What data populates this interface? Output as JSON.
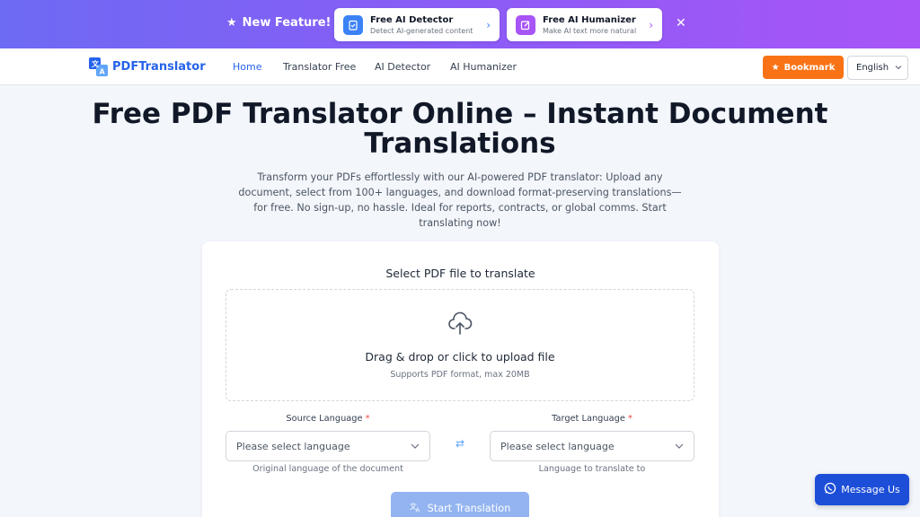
{
  "promo": {
    "label": "New Feature!",
    "cards": [
      {
        "title": "Free AI Detector",
        "subtitle": "Detect AI-generated content"
      },
      {
        "title": "Free AI Humanizer",
        "subtitle": "Make AI text more natural"
      }
    ],
    "close_label": "✕"
  },
  "nav": {
    "brand": "PDFTranslator",
    "links": [
      "Home",
      "Translator Free",
      "AI Detector",
      "AI Humanizer"
    ],
    "bookmark_label": "Bookmark",
    "language": "English"
  },
  "hero": {
    "title": "Free PDF Translator Online – Instant Document Translations",
    "subtitle": "Transform your PDFs effortlessly with our AI-powered PDF translator: Upload any document, select from 100+ languages, and download format-preserving translations—for free. No sign-up, no hassle. Ideal for reports, contracts, or global comms. Start translating now!"
  },
  "upload": {
    "title": "Select PDF file to translate",
    "drop_text": "Drag & drop or click to upload file",
    "drop_hint": "Supports PDF format, max 20MB"
  },
  "source": {
    "label": "Source Language",
    "required_mark": "*",
    "placeholder": "Please select language",
    "hint": "Original language of the document"
  },
  "target": {
    "label": "Target Language",
    "required_mark": "*",
    "placeholder": "Please select language",
    "hint": "Language to translate to"
  },
  "start_label": "Start Translation",
  "chat_label": "Message Us",
  "colors": {
    "accent": "#2563eb",
    "bookmark": "#f97316",
    "promo_start": "#6d6af3",
    "promo_end": "#a855f7"
  }
}
